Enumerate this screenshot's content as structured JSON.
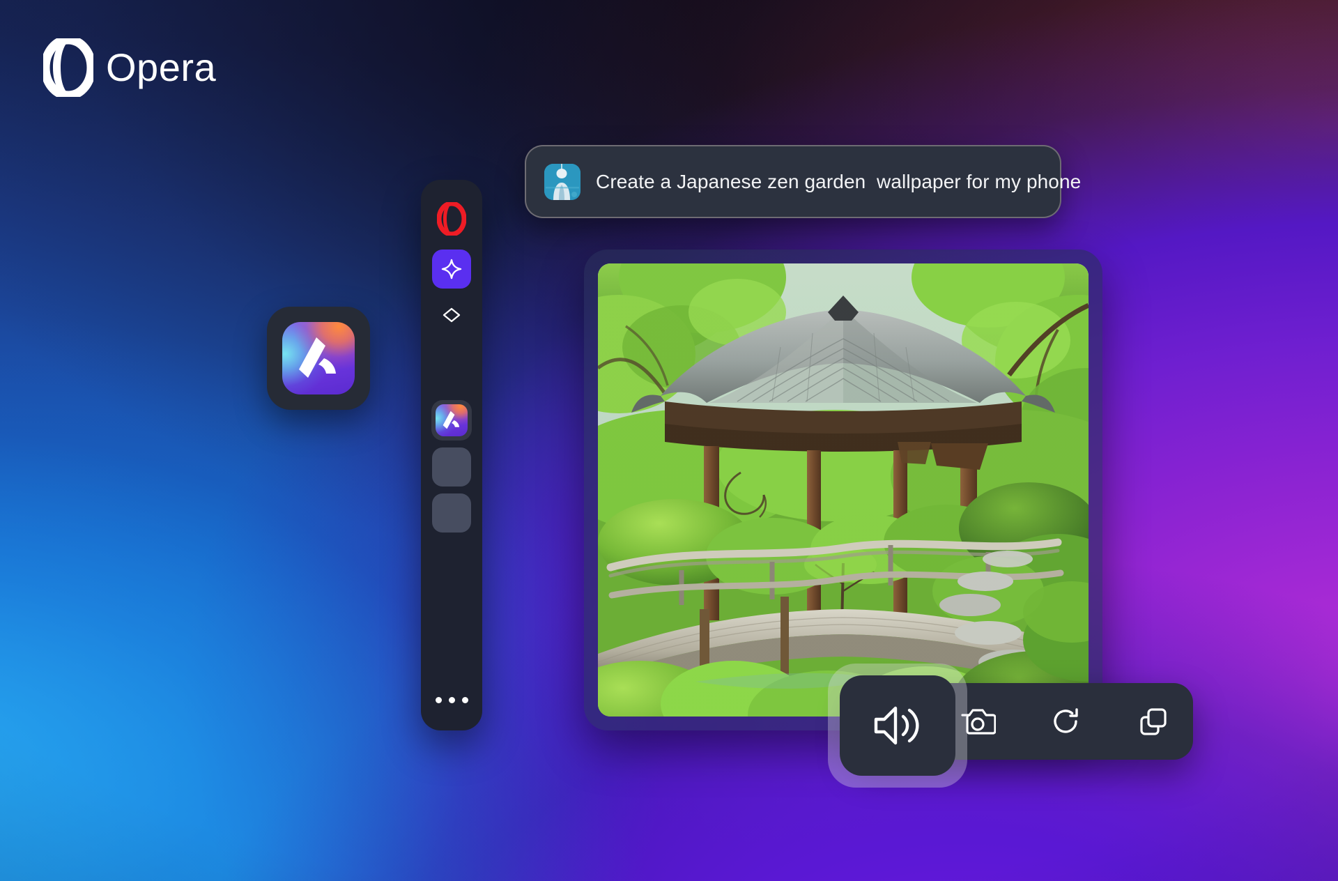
{
  "brand": {
    "logo_icon": "opera-logo-icon",
    "wordmark": "Opera"
  },
  "prompt": {
    "avatar_icon": "user-avatar",
    "text": "Create a Japanese zen garden  wallpaper for my phone"
  },
  "floating_app": {
    "icon_name": "aria-app-icon",
    "label": "Aria"
  },
  "sidebar": {
    "items": [
      {
        "name": "opera-menu-button",
        "icon": "opera-o-icon",
        "label": "Opera"
      },
      {
        "name": "sidebar-item-aria",
        "icon": "sparkle-star-icon",
        "label": "Aria",
        "active": true
      },
      {
        "name": "sidebar-item-gem",
        "icon": "diamond-gem-icon",
        "label": "Rewards"
      }
    ],
    "pinned": [
      {
        "name": "sidebar-pinned-aria",
        "icon": "aria-app-icon",
        "label": "Aria",
        "active": true
      },
      {
        "name": "sidebar-pinned-slot-1",
        "icon": "empty-slot-icon",
        "label": ""
      },
      {
        "name": "sidebar-pinned-slot-2",
        "icon": "empty-slot-icon",
        "label": ""
      }
    ],
    "more": {
      "name": "sidebar-more-button",
      "icon": "ellipsis-icon",
      "label": "More"
    }
  },
  "image_result": {
    "alt": "Japanese zen garden with wooden pagoda, moss mounds, arched bridge and stepping stones",
    "scene": {
      "sky": "#c9dce6",
      "foliage": "#8fd13f",
      "roof": "#9aa0a0",
      "wood": "#6b4a2c",
      "moss": "#79bf3c",
      "stone": "#b9bdb6"
    }
  },
  "toolbar": {
    "buttons": [
      {
        "name": "read-aloud-button",
        "icon": "speaker-icon",
        "label": "Read aloud",
        "active": true
      },
      {
        "name": "screenshot-button",
        "icon": "camera-icon",
        "label": "Screenshot"
      },
      {
        "name": "regenerate-button",
        "icon": "refresh-icon",
        "label": "Regenerate"
      },
      {
        "name": "copy-button",
        "icon": "copy-icon",
        "label": "Copy"
      }
    ]
  },
  "colors": {
    "blue": "#1a8fe0",
    "purple": "#7c1fd0",
    "magenta": "#b82fd6",
    "maroon": "#3a1620",
    "opera_red": "#ee1c25",
    "sidebar_bg": "#1e2230",
    "panel_bg": "#2a2f3c",
    "accent_violet": "#5a2ff0"
  }
}
